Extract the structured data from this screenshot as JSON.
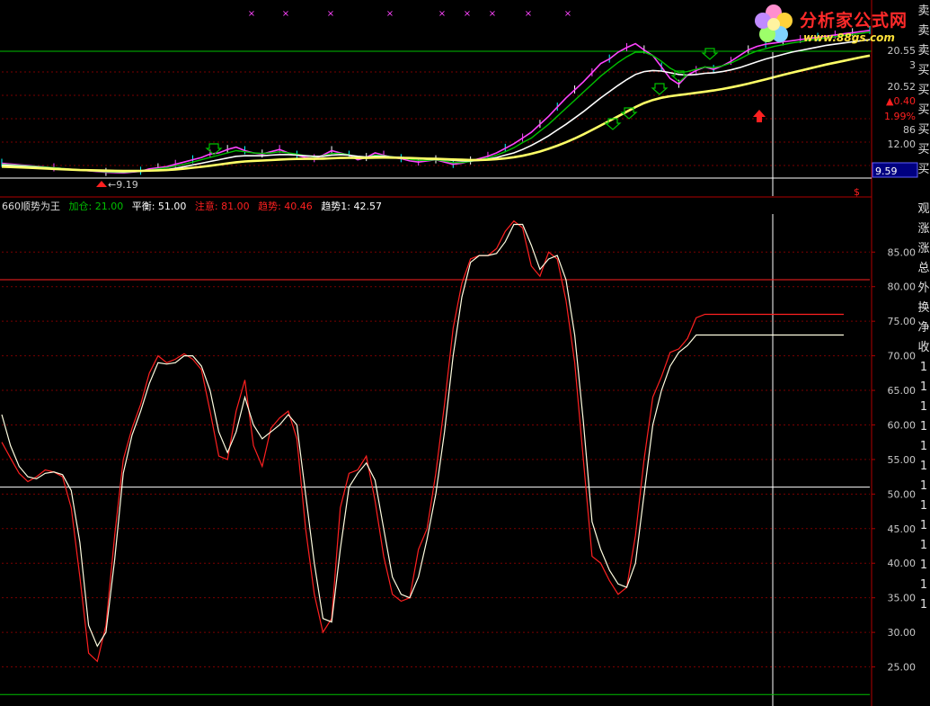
{
  "colors": {
    "background": "#000000",
    "grid": "#7a0000",
    "axis": "#b00000",
    "axis_text": "#c8c8c8",
    "white_line": "#ffffff",
    "green_line": "#00c000",
    "magenta_line": "#ff44ff",
    "yellow_line": "#ffff66",
    "red_line": "#ff2020",
    "cyan": "#00ffff",
    "highlight_box": "#000080"
  },
  "logo": {
    "title": "分析家公式网",
    "url": "www.88gs.com"
  },
  "top_markers": [
    "×",
    "×",
    "×",
    "×",
    "×",
    "×",
    "×",
    "×",
    "×"
  ],
  "price_panel": {
    "low_label": "9.19",
    "right_labels": [
      "20.55",
      "3",
      "20.52",
      "▲0.40",
      "1.99%",
      "86",
      "12.00"
    ],
    "crosshair_value": "9.59",
    "dollar_marker": "$",
    "right_column_chars": [
      "卖",
      "卖",
      "卖",
      "买",
      "买",
      "买",
      "买",
      "买",
      "买"
    ]
  },
  "indicator_panel": {
    "name": "660顺势为王",
    "legend": [
      {
        "label": "加仓: 21.00",
        "color": "#00c000"
      },
      {
        "label": "平衡: 51.00",
        "color": "#ffffff"
      },
      {
        "label": "注意: 81.00",
        "color": "#ff2020"
      },
      {
        "label": "趋势: 40.46",
        "color": "#ff2020"
      },
      {
        "label": "趋势1: 42.57",
        "color": "#ffffff"
      }
    ],
    "right_column_chars": [
      "观",
      "涨",
      "涨",
      "总",
      "外",
      "换",
      "净",
      "收",
      "1",
      "1",
      "1",
      "1",
      "1",
      "1",
      "1",
      "1",
      "1",
      "1",
      "1",
      "1",
      "1"
    ]
  },
  "chart_data": [
    {
      "type": "line",
      "panel": "price",
      "x": [
        0,
        3,
        6,
        9,
        12,
        14,
        16,
        17,
        18,
        19,
        20,
        21,
        22,
        23,
        24,
        25,
        26,
        27,
        28,
        29,
        30,
        31,
        32,
        33,
        34,
        35,
        36,
        37,
        38,
        39,
        40,
        41,
        42,
        43,
        44,
        45,
        46,
        47,
        48,
        49,
        50,
        51,
        52,
        53,
        54,
        55,
        56,
        57,
        58,
        59,
        60,
        61,
        62,
        63,
        64,
        65,
        66,
        67,
        68,
        69,
        70,
        71,
        72,
        73,
        74,
        75,
        76,
        77,
        78,
        79,
        80,
        81,
        82,
        83,
        84,
        85,
        86,
        87,
        88,
        89,
        90,
        91,
        92,
        93,
        94,
        95,
        96,
        97,
        98,
        99,
        100
      ],
      "series": [
        {
          "values": [
            10.1,
            9.9,
            9.7,
            9.5,
            9.3,
            9.25,
            9.4,
            9.6,
            9.7,
            9.8,
            10.0,
            10.2,
            10.4,
            10.6,
            10.9,
            11.0,
            11.3,
            11.5,
            11.2,
            11.0,
            10.9,
            11.1,
            11.3,
            11.0,
            10.8,
            10.6,
            10.5,
            10.8,
            11.2,
            11.0,
            10.8,
            10.4,
            10.6,
            11.0,
            10.8,
            10.6,
            10.5,
            10.3,
            10.2,
            10.3,
            10.4,
            10.2,
            10.0,
            10.1,
            10.3,
            10.5,
            10.7,
            11.0,
            11.4,
            11.8,
            12.3,
            12.8,
            13.5,
            14.2,
            15.0,
            15.8,
            16.5,
            17.2,
            18.0,
            18.8,
            19.2,
            19.8,
            20.2,
            20.55,
            20.0,
            19.5,
            18.5,
            17.5,
            17.0,
            17.8,
            18.2,
            18.5,
            18.3,
            18.6,
            19.0,
            19.5,
            20.0,
            20.3,
            20.5,
            20.6,
            20.7,
            20.8,
            20.9,
            21.0,
            21.1,
            21.2,
            21.3,
            21.4,
            21.5,
            21.6,
            21.7
          ]
        },
        {
          "values": [
            10.0,
            9.85,
            9.7,
            9.5,
            9.35,
            9.3,
            9.4,
            9.5,
            9.6,
            9.7,
            9.85,
            10.0,
            10.2,
            10.4,
            10.6,
            10.8,
            11.0,
            11.2,
            11.1,
            11.0,
            10.95,
            11.0,
            11.1,
            11.0,
            10.9,
            10.75,
            10.65,
            10.75,
            10.95,
            10.95,
            10.85,
            10.6,
            10.6,
            10.8,
            10.75,
            10.65,
            10.55,
            10.45,
            10.35,
            10.35,
            10.4,
            10.3,
            10.15,
            10.15,
            10.25,
            10.4,
            10.55,
            10.8,
            11.1,
            11.45,
            11.9,
            12.3,
            12.9,
            13.5,
            14.2,
            14.9,
            15.6,
            16.3,
            17.0,
            17.7,
            18.3,
            18.9,
            19.4,
            19.8,
            19.8,
            19.5,
            19.0,
            18.4,
            18.0,
            18.1,
            18.3,
            18.5,
            18.45,
            18.6,
            18.85,
            19.2,
            19.6,
            19.9,
            20.1,
            20.3,
            20.45,
            20.6,
            20.7,
            20.85,
            20.95,
            21.05,
            21.15,
            21.25,
            21.35,
            21.45,
            21.55
          ]
        },
        {
          "values": [
            9.95,
            9.8,
            9.65,
            9.5,
            9.4,
            9.35,
            9.4,
            9.45,
            9.5,
            9.55,
            9.65,
            9.8,
            9.95,
            10.1,
            10.25,
            10.4,
            10.55,
            10.7,
            10.75,
            10.75,
            10.75,
            10.8,
            10.85,
            10.85,
            10.8,
            10.75,
            10.7,
            10.7,
            10.8,
            10.85,
            10.8,
            10.7,
            10.65,
            10.7,
            10.7,
            10.65,
            10.6,
            10.55,
            10.5,
            10.45,
            10.45,
            10.4,
            10.35,
            10.3,
            10.3,
            10.35,
            10.45,
            10.6,
            10.8,
            11.0,
            11.3,
            11.65,
            12.05,
            12.5,
            13.0,
            13.5,
            14.05,
            14.6,
            15.2,
            15.8,
            16.35,
            16.9,
            17.4,
            17.85,
            18.1,
            18.2,
            18.15,
            18.0,
            17.85,
            17.8,
            17.85,
            17.95,
            18.0,
            18.1,
            18.25,
            18.45,
            18.7,
            18.95,
            19.2,
            19.4,
            19.6,
            19.8,
            19.95,
            20.1,
            20.25,
            20.4,
            20.5,
            20.6,
            20.7,
            20.8,
            20.9
          ]
        },
        {
          "values": [
            9.8,
            9.7,
            9.6,
            9.5,
            9.45,
            9.42,
            9.43,
            9.45,
            9.47,
            9.5,
            9.55,
            9.62,
            9.7,
            9.78,
            9.88,
            9.98,
            10.08,
            10.18,
            10.25,
            10.3,
            10.33,
            10.37,
            10.42,
            10.45,
            10.47,
            10.48,
            10.48,
            10.5,
            10.53,
            10.56,
            10.57,
            10.56,
            10.56,
            10.58,
            10.59,
            10.58,
            10.57,
            10.55,
            10.53,
            10.5,
            10.48,
            10.46,
            10.43,
            10.4,
            10.38,
            10.38,
            10.4,
            10.45,
            10.52,
            10.62,
            10.75,
            10.92,
            11.12,
            11.36,
            11.63,
            11.93,
            12.26,
            12.62,
            13.0,
            13.4,
            13.8,
            14.2,
            14.6,
            15.0,
            15.35,
            15.62,
            15.82,
            15.95,
            16.05,
            16.15,
            16.25,
            16.35,
            16.45,
            16.58,
            16.72,
            16.88,
            17.05,
            17.24,
            17.43,
            17.62,
            17.82,
            18.0,
            18.18,
            18.36,
            18.54,
            18.72,
            18.88,
            19.04,
            19.2,
            19.36,
            19.5
          ]
        }
      ],
      "ylim": [
        8.8,
        22.0
      ],
      "xlim": [
        0,
        100
      ]
    },
    {
      "type": "line",
      "panel": "indicator",
      "x": [
        0,
        1,
        2,
        3,
        4,
        5,
        6,
        7,
        8,
        9,
        10,
        11,
        12,
        13,
        14,
        15,
        16,
        17,
        18,
        19,
        20,
        21,
        22,
        23,
        24,
        25,
        26,
        27,
        28,
        29,
        30,
        31,
        32,
        33,
        34,
        35,
        36,
        37,
        38,
        39,
        40,
        41,
        42,
        43,
        44,
        45,
        46,
        47,
        48,
        49,
        50,
        51,
        52,
        53,
        54,
        55,
        56,
        57,
        58,
        59,
        60,
        61,
        62,
        63,
        64,
        65,
        66,
        67,
        68,
        69,
        70,
        71,
        72,
        73,
        74,
        75,
        76,
        77,
        78,
        79,
        80,
        81,
        82,
        83,
        84,
        85,
        86,
        87,
        88,
        89,
        90,
        91,
        92,
        93,
        94,
        95,
        96,
        97,
        98,
        99,
        100
      ],
      "series": [
        {
          "name": "趋势",
          "values": [
            57.5,
            55.2,
            53.0,
            51.8,
            52.5,
            53.5,
            53.2,
            52.5,
            48.0,
            38.0,
            27.0,
            25.8,
            31.0,
            44.0,
            55.0,
            59.5,
            63.0,
            67.5,
            70.0,
            69.0,
            69.5,
            70.3,
            69.5,
            68.0,
            62.0,
            55.5,
            55.0,
            62.0,
            66.5,
            57.0,
            54.0,
            59.5,
            61.0,
            62.0,
            58.0,
            45.0,
            35.5,
            30.0,
            32.0,
            48.0,
            53.0,
            53.5,
            55.5,
            49.0,
            41.0,
            35.5,
            34.5,
            35.0,
            42.0,
            45.0,
            53.0,
            63.0,
            74.0,
            80.5,
            84.0,
            84.5,
            84.5,
            85.5,
            88.0,
            89.5,
            88.5,
            83.0,
            81.5,
            85.0,
            84.0,
            78.0,
            69.0,
            55.0,
            41.0,
            40.0,
            37.5,
            35.5,
            36.5,
            44.0,
            55.0,
            64.0,
            67.0,
            70.5,
            71.0,
            72.5,
            75.5,
            76.0,
            76.0,
            76.0,
            76.0,
            76.0,
            76.0,
            76.0,
            76.0,
            76.0,
            76.0,
            76.0,
            76.0,
            76.0,
            76.0,
            76.0,
            76.0,
            76.0,
            76.0,
            76.0,
            76.0
          ]
        },
        {
          "name": "趋势1",
          "values": [
            61.5,
            57.0,
            54.0,
            52.5,
            52.2,
            53.0,
            53.2,
            52.8,
            50.5,
            43.0,
            31.0,
            28.0,
            30.0,
            40.5,
            53.0,
            58.5,
            62.0,
            66.0,
            69.0,
            68.8,
            69.0,
            70.0,
            70.0,
            68.5,
            65.0,
            59.0,
            56.0,
            59.0,
            64.0,
            60.0,
            58.0,
            59.0,
            60.0,
            61.5,
            60.0,
            50.0,
            40.0,
            32.0,
            31.5,
            42.0,
            51.0,
            53.0,
            54.5,
            52.0,
            45.0,
            38.0,
            35.5,
            35.0,
            38.0,
            43.5,
            50.0,
            59.0,
            70.0,
            78.5,
            83.5,
            84.5,
            84.5,
            84.8,
            86.5,
            89.0,
            89.0,
            86.0,
            82.5,
            84.0,
            84.5,
            81.0,
            73.0,
            60.5,
            46.0,
            42.0,
            39.0,
            37.0,
            36.5,
            40.0,
            50.0,
            60.0,
            65.0,
            68.5,
            70.5,
            71.5,
            73.0,
            73.0,
            73.0,
            73.0,
            73.0,
            73.0,
            73.0,
            73.0,
            73.0,
            73.0,
            73.0,
            73.0,
            73.0,
            73.0,
            73.0,
            73.0,
            73.0,
            73.0,
            73.0,
            73.0,
            73.0
          ]
        }
      ],
      "reference_lines": [
        {
          "value": 21.0,
          "color": "#00c000"
        },
        {
          "value": 51.0,
          "color": "#ffffff"
        },
        {
          "value": 81.0,
          "color": "#ff2020"
        }
      ],
      "ticks": [
        "85.00",
        "80.00",
        "75.00",
        "70.00",
        "65.00",
        "60.00",
        "55.00",
        "50.00",
        "45.00",
        "40.00",
        "35.00",
        "30.00",
        "25.00"
      ],
      "ylim": [
        20.0,
        90.5
      ],
      "xlim": [
        0,
        100
      ]
    }
  ]
}
